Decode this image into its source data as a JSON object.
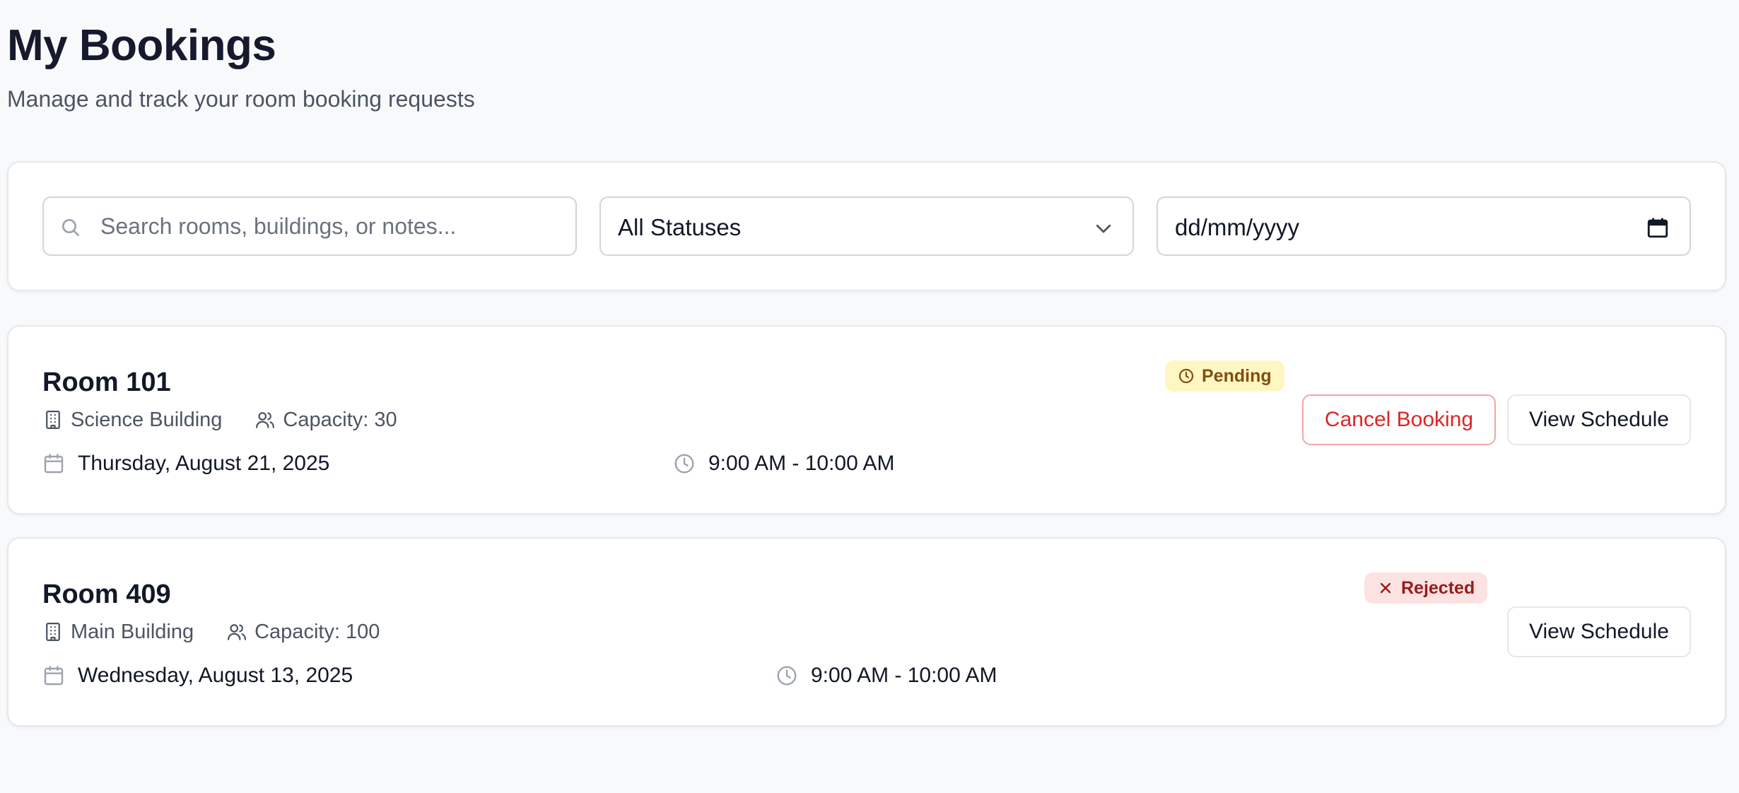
{
  "header": {
    "title": "My Bookings",
    "subtitle": "Manage and track your room booking requests"
  },
  "filters": {
    "search_placeholder": "Search rooms, buildings, or notes...",
    "status_selected": "All Statuses",
    "date_placeholder": "dd/mm/yyyy"
  },
  "icons": {
    "search": "search-icon",
    "chevron": "chevron-down-icon",
    "calendar_picker": "calendar-icon",
    "building": "building-icon",
    "users": "users-icon",
    "calendar": "calendar-icon",
    "clock": "clock-icon",
    "close": "x-icon"
  },
  "colors": {
    "pending_bg": "#fef7c3",
    "pending_text": "#854d0e",
    "rejected_bg": "#fde2e2",
    "rejected_text": "#991b1b",
    "cancel_text": "#dc2626"
  },
  "bookings": [
    {
      "room": "Room 101",
      "building": "Science Building",
      "capacity": "Capacity: 30",
      "date": "Thursday, August 21, 2025",
      "time": "9:00 AM - 10:00 AM",
      "status": "Pending",
      "cancel_label": "Cancel Booking",
      "view_label": "View Schedule"
    },
    {
      "room": "Room 409",
      "building": "Main Building",
      "capacity": "Capacity: 100",
      "date": "Wednesday, August 13, 2025",
      "time": "9:00 AM - 10:00 AM",
      "status": "Rejected",
      "view_label": "View Schedule"
    }
  ]
}
